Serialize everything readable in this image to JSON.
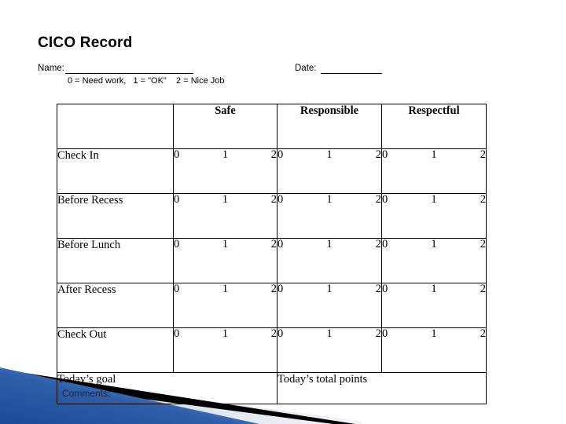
{
  "slide": {
    "title": "CICO Record",
    "background_color": "#ffffff"
  },
  "form_fields": {
    "name_label": "Name:",
    "name_value": "",
    "date_label": "Date:",
    "date_value": "",
    "scale_legend": "0 = Need work,   1 = \"OK\"    2 = Nice Job"
  },
  "table": {
    "headers": [
      "",
      "Safe",
      "Responsible",
      "Respectful"
    ],
    "rows": [
      {
        "label": "Check In",
        "safe": [
          "0",
          "1",
          "2"
        ],
        "responsible": [
          "0",
          "1",
          "2"
        ],
        "respectful": [
          "0",
          "1",
          "2"
        ]
      },
      {
        "label": "Before Recess",
        "safe": [
          "0",
          "1",
          "2"
        ],
        "responsible": [
          "0",
          "1",
          "2"
        ],
        "respectful": [
          "0",
          "1",
          "2"
        ]
      },
      {
        "label": "Before Lunch",
        "safe": [
          "0",
          "1",
          "2"
        ],
        "responsible": [
          "0",
          "1",
          "2"
        ],
        "respectful": [
          "0",
          "1",
          "2"
        ]
      },
      {
        "label": "After Recess",
        "safe": [
          "0",
          "1",
          "2"
        ],
        "responsible": [
          "0",
          "1",
          "2"
        ],
        "respectful": [
          "0",
          "1",
          "2"
        ]
      },
      {
        "label": "Check Out",
        "safe": [
          "0",
          "1",
          "2"
        ],
        "responsible": [
          "0",
          "1",
          "2"
        ],
        "respectful": [
          "0",
          "1",
          "2"
        ]
      }
    ],
    "summary": {
      "goal_label": "Today’s goal",
      "goal_value": "",
      "total_label": "Today’s total points",
      "total_value": ""
    },
    "border_color": "#000000"
  },
  "comments": {
    "label": "Comments:",
    "text_color": "#1d2435"
  },
  "decoration": {
    "name": "corner-wedge",
    "blue_dark": "#1f4e9c",
    "blue_mid": "#3f6fba",
    "blue_light": "#9fb6da",
    "stripe_color": "#000000",
    "pale_wedge": "#dde2ee"
  }
}
